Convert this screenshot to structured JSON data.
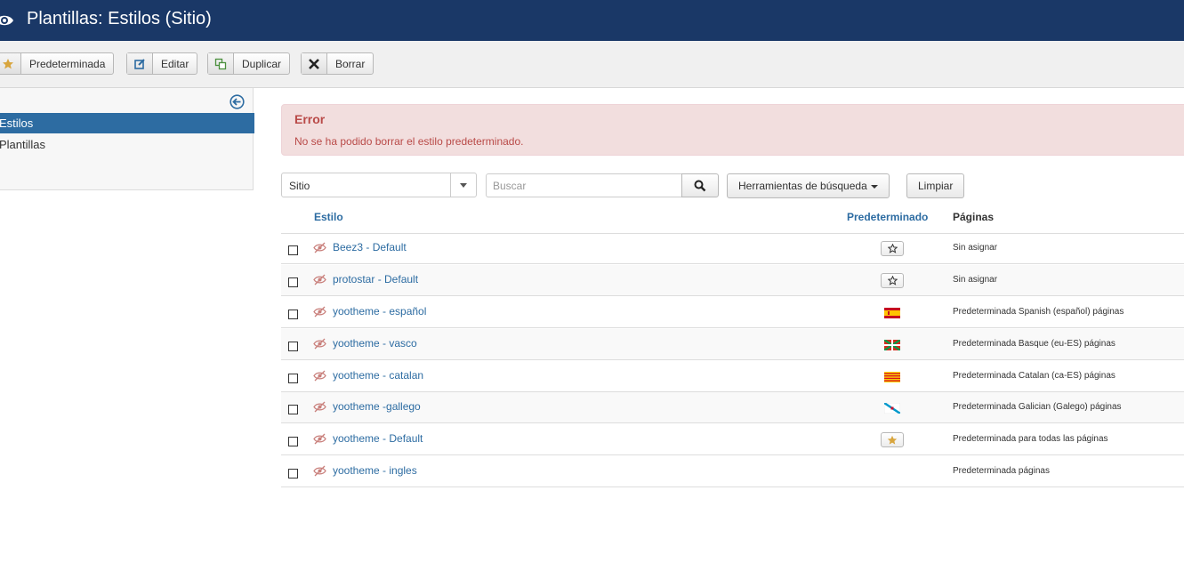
{
  "header": {
    "title": "Plantillas: Estilos (Sitio)"
  },
  "toolbar": {
    "default_label": "Predeterminada",
    "edit_label": "Editar",
    "duplicate_label": "Duplicar",
    "delete_label": "Borrar"
  },
  "sidebar": {
    "items": [
      {
        "label": "Estilos",
        "active": true
      },
      {
        "label": "Plantillas",
        "active": false
      }
    ]
  },
  "alert": {
    "heading": "Error",
    "message": "No se ha podido borrar el estilo predeterminado."
  },
  "filters": {
    "client_select": "Sitio",
    "search_placeholder": "Buscar",
    "search_tools_label": "Herramientas de búsqueda",
    "clear_label": "Limpiar"
  },
  "table": {
    "headers": {
      "style": "Estilo",
      "default": "Predeterminado",
      "pages": "Páginas"
    },
    "rows": [
      {
        "name": "Beez3 - Default",
        "default": "star-empty",
        "pages": "Sin asignar"
      },
      {
        "name": "protostar - Default",
        "default": "star-empty",
        "pages": "Sin asignar"
      },
      {
        "name": "yootheme - español",
        "default": "flag-es",
        "pages": "Predeterminada Spanish (español) páginas"
      },
      {
        "name": "yootheme - vasco",
        "default": "flag-eu",
        "pages": "Predeterminada Basque (eu-ES) páginas"
      },
      {
        "name": "yootheme - catalan",
        "default": "flag-ca",
        "pages": "Predeterminada Catalan (ca-ES) páginas"
      },
      {
        "name": "yootheme -gallego",
        "default": "flag-gl",
        "pages": "Predeterminada Galician (Galego) páginas"
      },
      {
        "name": "yootheme - Default",
        "default": "star-filled",
        "pages": "Predeterminada para todas las páginas"
      },
      {
        "name": "yootheme - ingles",
        "default": "none",
        "pages": "Predeterminada páginas"
      }
    ]
  },
  "colors": {
    "header_bg": "#1a3867",
    "link": "#2d6ca2",
    "error_bg": "#f2dede",
    "error_text": "#b94a48",
    "star": "#d8a53d"
  }
}
